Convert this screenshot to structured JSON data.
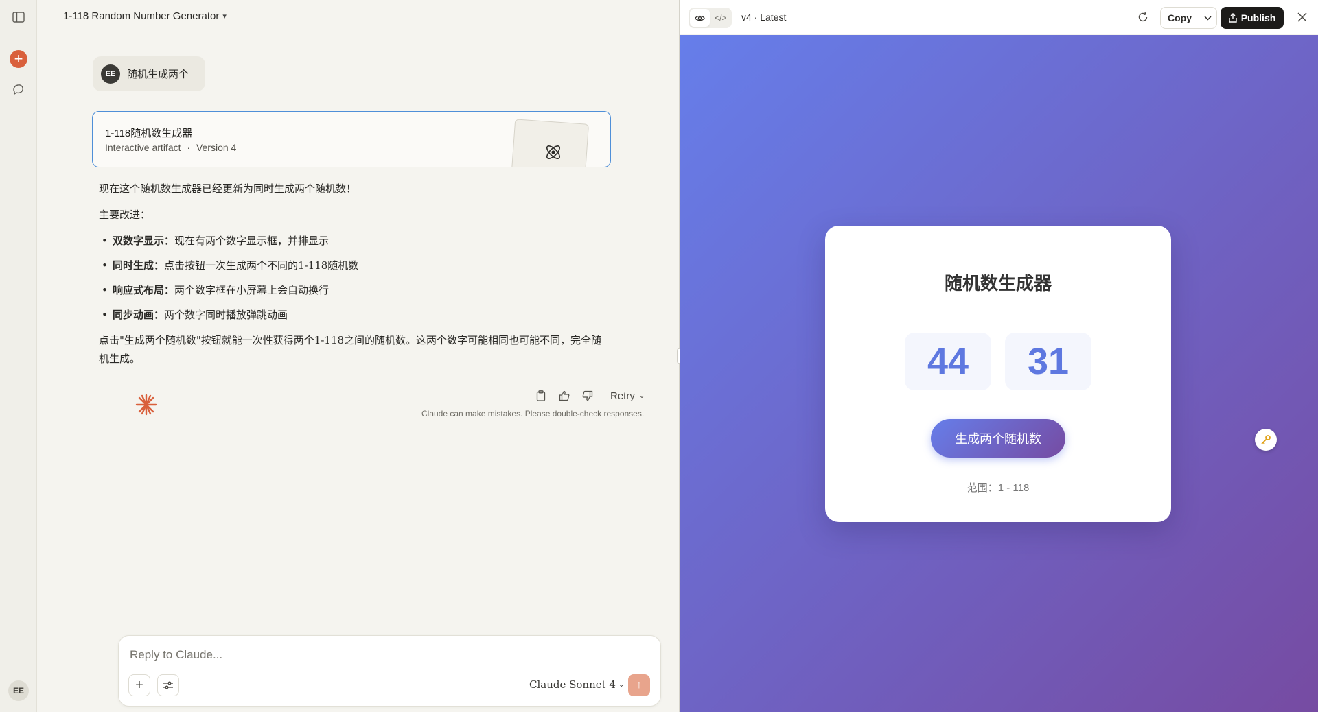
{
  "chat": {
    "title": "1-118 Random Number Generator",
    "user_avatar_initials": "EE",
    "user_message": "随机生成两个",
    "artifact": {
      "title": "1-118随机数生成器",
      "kind": "Interactive artifact",
      "separator": "·",
      "version": "Version 4"
    },
    "reply": {
      "intro": "现在这个随机数生成器已经更新为同时生成两个随机数！",
      "subhead": "主要改进：",
      "bullets": [
        {
          "term": "双数字显示：",
          "text": "现在有两个数字显示框，并排显示"
        },
        {
          "term": "同时生成：",
          "text": "点击按钮一次生成两个不同的1-118随机数"
        },
        {
          "term": "响应式布局：",
          "text": "两个数字框在小屏幕上会自动换行"
        },
        {
          "term": "同步动画：",
          "text": "两个数字同时播放弹跳动画"
        }
      ],
      "outro": "点击\"生成两个随机数\"按钮就能一次性获得两个1-118之间的随机数。这两个数字可能相同也可能不同，完全随机生成。"
    },
    "actions": {
      "retry_label": "Retry"
    },
    "disclaimer": "Claude can make mistakes. Please double-check responses.",
    "composer": {
      "placeholder": "Reply to Claude...",
      "model": "Claude Sonnet 4"
    }
  },
  "rail": {
    "avatar_initials": "EE"
  },
  "panel": {
    "version_label": "v4 · Latest",
    "copy_label": "Copy",
    "publish_label": "Publish",
    "app": {
      "title": "随机数生成器",
      "number_1": "44",
      "number_2": "31",
      "button_label": "生成两个随机数",
      "range_text": "范围：1 - 118"
    }
  },
  "colors": {
    "accent": "#d9603c",
    "artifact_border": "#4f8fd8",
    "gradient_start": "#667eea",
    "gradient_end": "#764ba2",
    "number_color": "#5e78e0"
  },
  "icons": {
    "rail": [
      "sidebar-toggle-icon",
      "new-chat-icon",
      "search-chats-icon"
    ],
    "artifact": "atom-icon",
    "actions": [
      "copy-icon",
      "thumbs-up-icon",
      "thumbs-down-icon"
    ],
    "panel": [
      "eye-icon",
      "code-icon",
      "refresh-icon",
      "chevron-down-icon",
      "share-icon",
      "close-icon",
      "key-icon"
    ]
  }
}
